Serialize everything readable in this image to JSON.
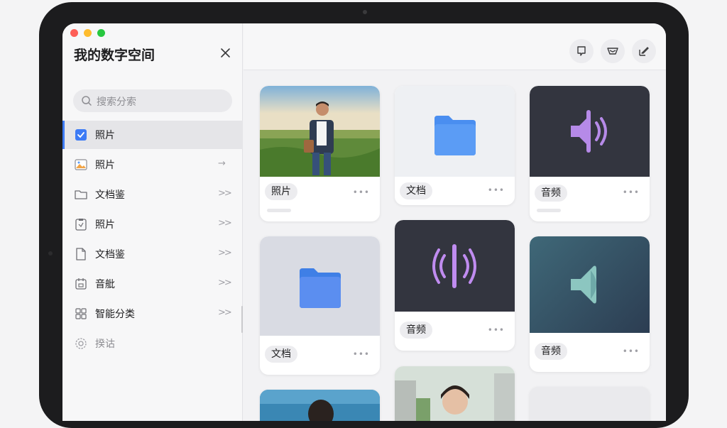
{
  "sidebar": {
    "title": "我的数字空间",
    "search_placeholder": "搜索分索",
    "items": [
      {
        "label": "照片",
        "icon": "checkbox-icon",
        "active": true,
        "chevron": ""
      },
      {
        "label": "照片",
        "icon": "image-icon",
        "active": false,
        "chevron": "⁻⁾"
      },
      {
        "label": "文档鉴",
        "icon": "folder-icon",
        "active": false,
        "chevron": ">>"
      },
      {
        "label": "照片",
        "icon": "clipboard-icon",
        "active": false,
        "chevron": ">>"
      },
      {
        "label": "文档鉴",
        "icon": "document-icon",
        "active": false,
        "chevron": ">>"
      },
      {
        "label": "音舭",
        "icon": "calendar-icon",
        "active": false,
        "chevron": ">>"
      },
      {
        "label": "智能分类",
        "icon": "grid-icon",
        "active": false,
        "chevron": ">>"
      },
      {
        "label": "揆诂",
        "icon": "gear-icon",
        "active": false,
        "chevron": ""
      }
    ]
  },
  "toolbar": {
    "buttons": [
      "comment-icon",
      "inbox-icon",
      "edit-icon"
    ]
  },
  "cards": [
    {
      "label": "照片",
      "kind": "photo-man",
      "more": "•••"
    },
    {
      "label": "文档",
      "kind": "folder",
      "more": "•••"
    },
    {
      "label": "音频",
      "kind": "audio-dark",
      "more": "•••"
    },
    {
      "label": "文档",
      "kind": "folder",
      "more": "•••"
    },
    {
      "label": "音频",
      "kind": "audio-dark",
      "more": "•••"
    },
    {
      "label": "音频",
      "kind": "audio-teal",
      "more": "•••"
    }
  ],
  "colors": {
    "accent": "#3d7bf5",
    "folder": "#5b9cf5",
    "audio_purple": "#b68ae8",
    "dark_card": "#33353f"
  }
}
